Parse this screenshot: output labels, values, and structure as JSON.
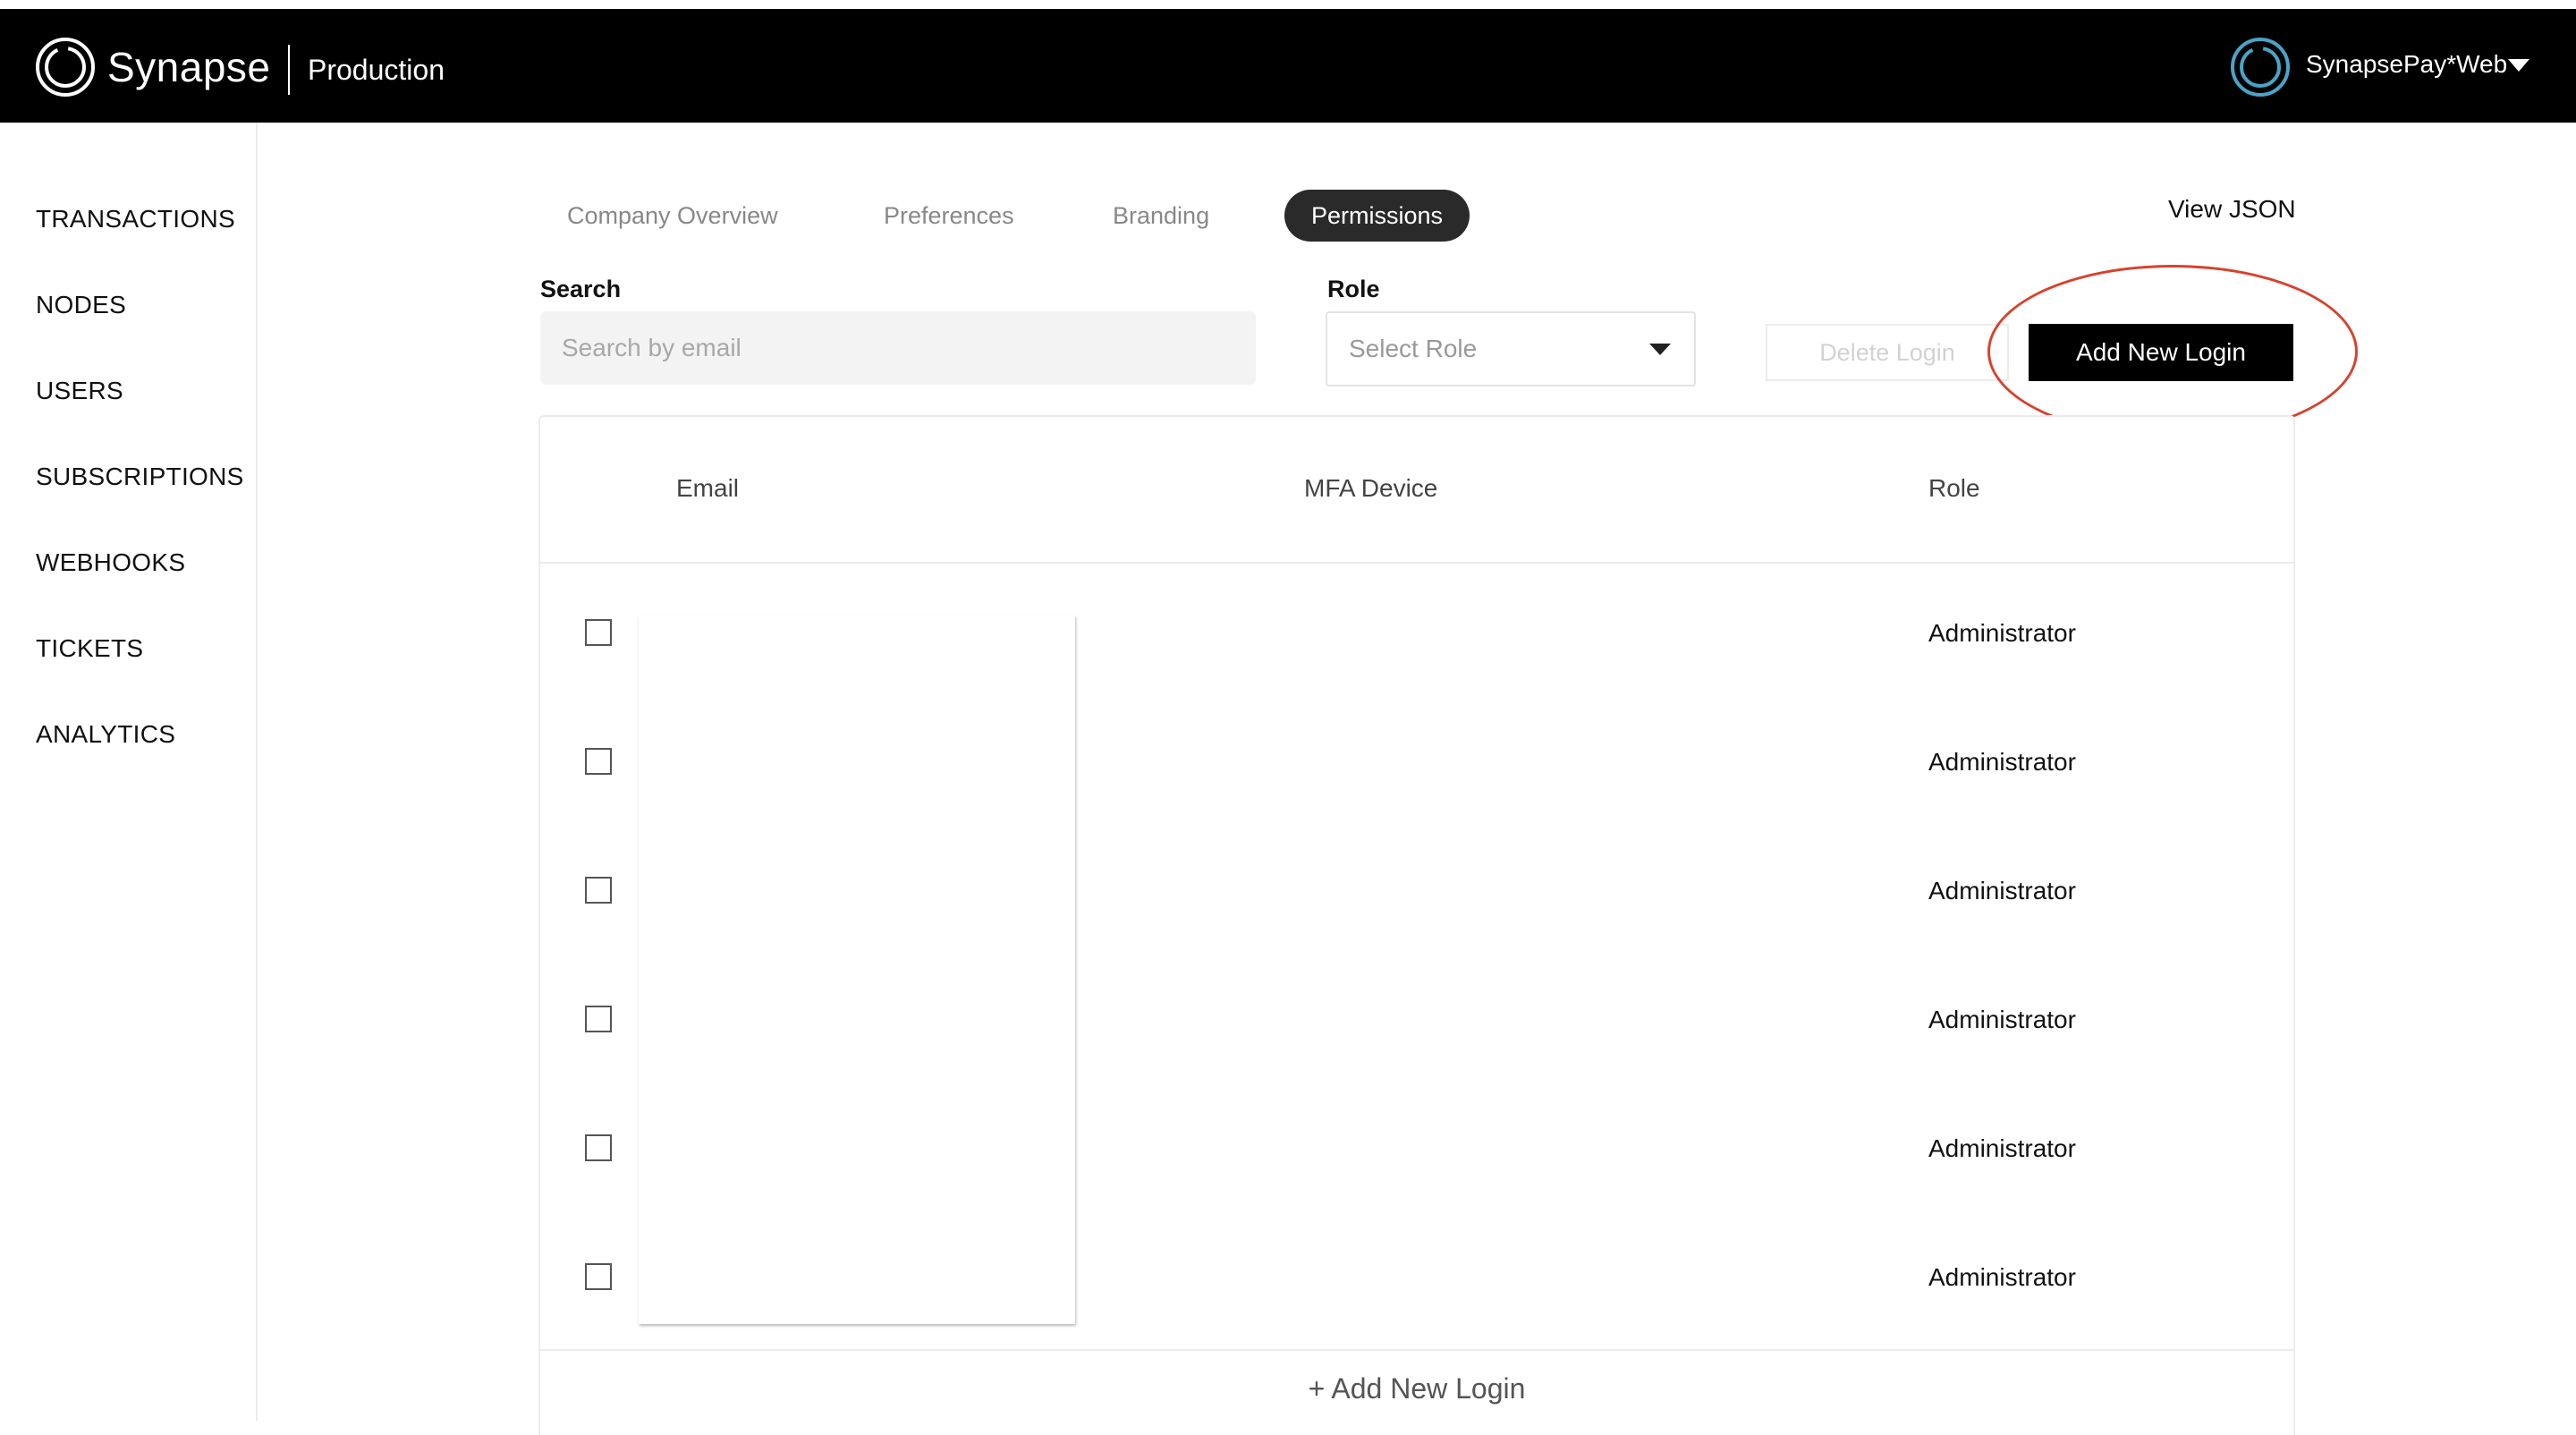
{
  "header": {
    "brand": "Synapse",
    "environment": "Production",
    "account_name": "SynapsePay*Web",
    "logo_icon": "synapse-ring-icon",
    "account_icon": "synapse-ring-icon"
  },
  "sidebar": {
    "items": [
      {
        "label": "TRANSACTIONS"
      },
      {
        "label": "NODES"
      },
      {
        "label": "USERS"
      },
      {
        "label": "SUBSCRIPTIONS"
      },
      {
        "label": "WEBHOOKS"
      },
      {
        "label": "TICKETS"
      },
      {
        "label": "ANALYTICS"
      }
    ]
  },
  "tabs": [
    {
      "label": "Company Overview",
      "active": false
    },
    {
      "label": "Preferences",
      "active": false
    },
    {
      "label": "Branding",
      "active": false
    },
    {
      "label": "Permissions",
      "active": true
    }
  ],
  "view_json_label": "View JSON",
  "filters": {
    "search_label": "Search",
    "search_placeholder": "Search by email",
    "role_label": "Role",
    "role_placeholder": "Select Role"
  },
  "actions": {
    "delete_label": "Delete Login",
    "add_label": "Add New Login"
  },
  "table": {
    "columns": [
      "Email",
      "MFA Device",
      "Role"
    ],
    "rows": [
      {
        "email": "",
        "mfa": "",
        "role": "Administrator"
      },
      {
        "email": "",
        "mfa": "",
        "role": "Administrator"
      },
      {
        "email": "",
        "mfa": "",
        "role": "Administrator"
      },
      {
        "email": "",
        "mfa": "",
        "role": "Administrator"
      },
      {
        "email": "",
        "mfa": "",
        "role": "Administrator"
      },
      {
        "email": "",
        "mfa": "",
        "role": "Administrator"
      }
    ],
    "add_row_label": "+ Add New Login"
  },
  "colors": {
    "header_bg": "#000000",
    "active_tab_bg": "#2a2a2a",
    "highlight_circle": "#d9412d",
    "account_ring": "#4aa3c7"
  }
}
